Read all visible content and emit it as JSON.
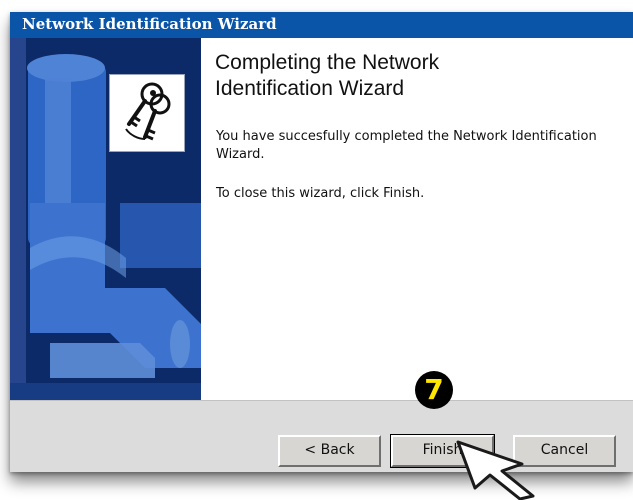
{
  "window": {
    "title": "Network Identification Wizard",
    "title_bar_color": "#0a55a8"
  },
  "side_panel": {
    "icon": "keys-icon"
  },
  "wizard": {
    "heading_line1": "Completing the Network",
    "heading_line2": "Identification Wizard",
    "message": "You have succesfully completed the Network Identification Wizard.",
    "instruction": "To close this wizard, click Finish."
  },
  "buttons": {
    "back": "< Back",
    "finish": "Finish",
    "cancel": "Cancel"
  },
  "annotation": {
    "step_number": "7",
    "badge_color": "#000000",
    "badge_text_color": "#ffe600",
    "pointer": "cursor-arrow-icon"
  }
}
